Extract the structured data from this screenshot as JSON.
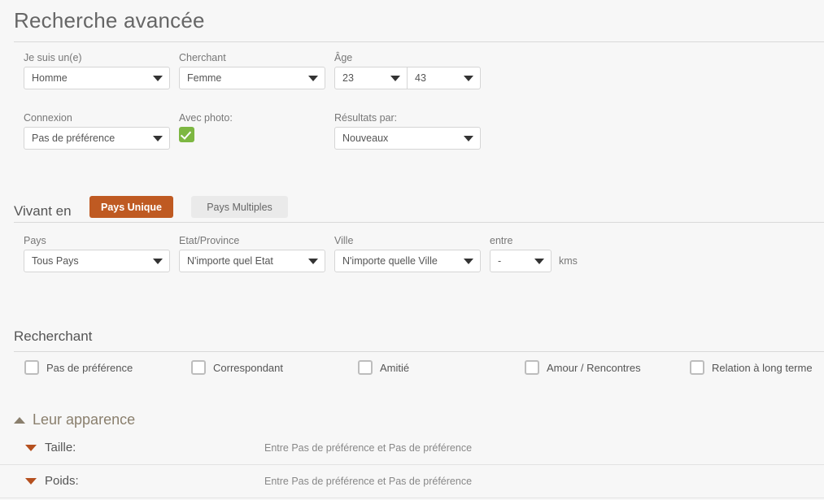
{
  "header": {
    "title": "Recherche avancée"
  },
  "basic": {
    "gender": {
      "label": "Je suis un(e)",
      "value": "Homme"
    },
    "seeking": {
      "label": "Cherchant",
      "value": "Femme"
    },
    "age": {
      "label": "Âge",
      "min": "23",
      "max": "43"
    },
    "connexion": {
      "label": "Connexion",
      "value": "Pas de préférence"
    },
    "photo": {
      "label": "Avec photo:",
      "checked": true
    },
    "results": {
      "label": "Résultats par:",
      "value": "Nouveaux"
    }
  },
  "living": {
    "heading": "Vivant en",
    "tab_single": "Pays Unique",
    "tab_multiple": "Pays Multiples",
    "country": {
      "label": "Pays",
      "value": "Tous Pays"
    },
    "state": {
      "label": "Etat/Province",
      "value": "N'importe quel Etat"
    },
    "city": {
      "label": "Ville",
      "value": "N'importe quelle Ville"
    },
    "distance": {
      "label": "entre",
      "value": "-",
      "unit": "kms"
    }
  },
  "seeking_section": {
    "heading": "Recherchant",
    "options": [
      {
        "label": "Pas de préférence",
        "checked": false
      },
      {
        "label": "Correspondant",
        "checked": false
      },
      {
        "label": "Amitié",
        "checked": false
      },
      {
        "label": "Amour / Rencontres",
        "checked": false
      },
      {
        "label": "Relation à long terme",
        "checked": false
      }
    ]
  },
  "appearance": {
    "heading": "Leur apparence",
    "rows": [
      {
        "name": "Taille:",
        "value": "Entre Pas de préférence et Pas de préférence"
      },
      {
        "name": "Poids:",
        "value": "Entre Pas de préférence et Pas de préférence"
      }
    ]
  },
  "colors": {
    "accent": "#bf5a22",
    "checkbox_green": "#7db742",
    "accordion_label": "#8a7f6d",
    "chevron_down": "#b5501f",
    "background": "#f7f7f7"
  }
}
